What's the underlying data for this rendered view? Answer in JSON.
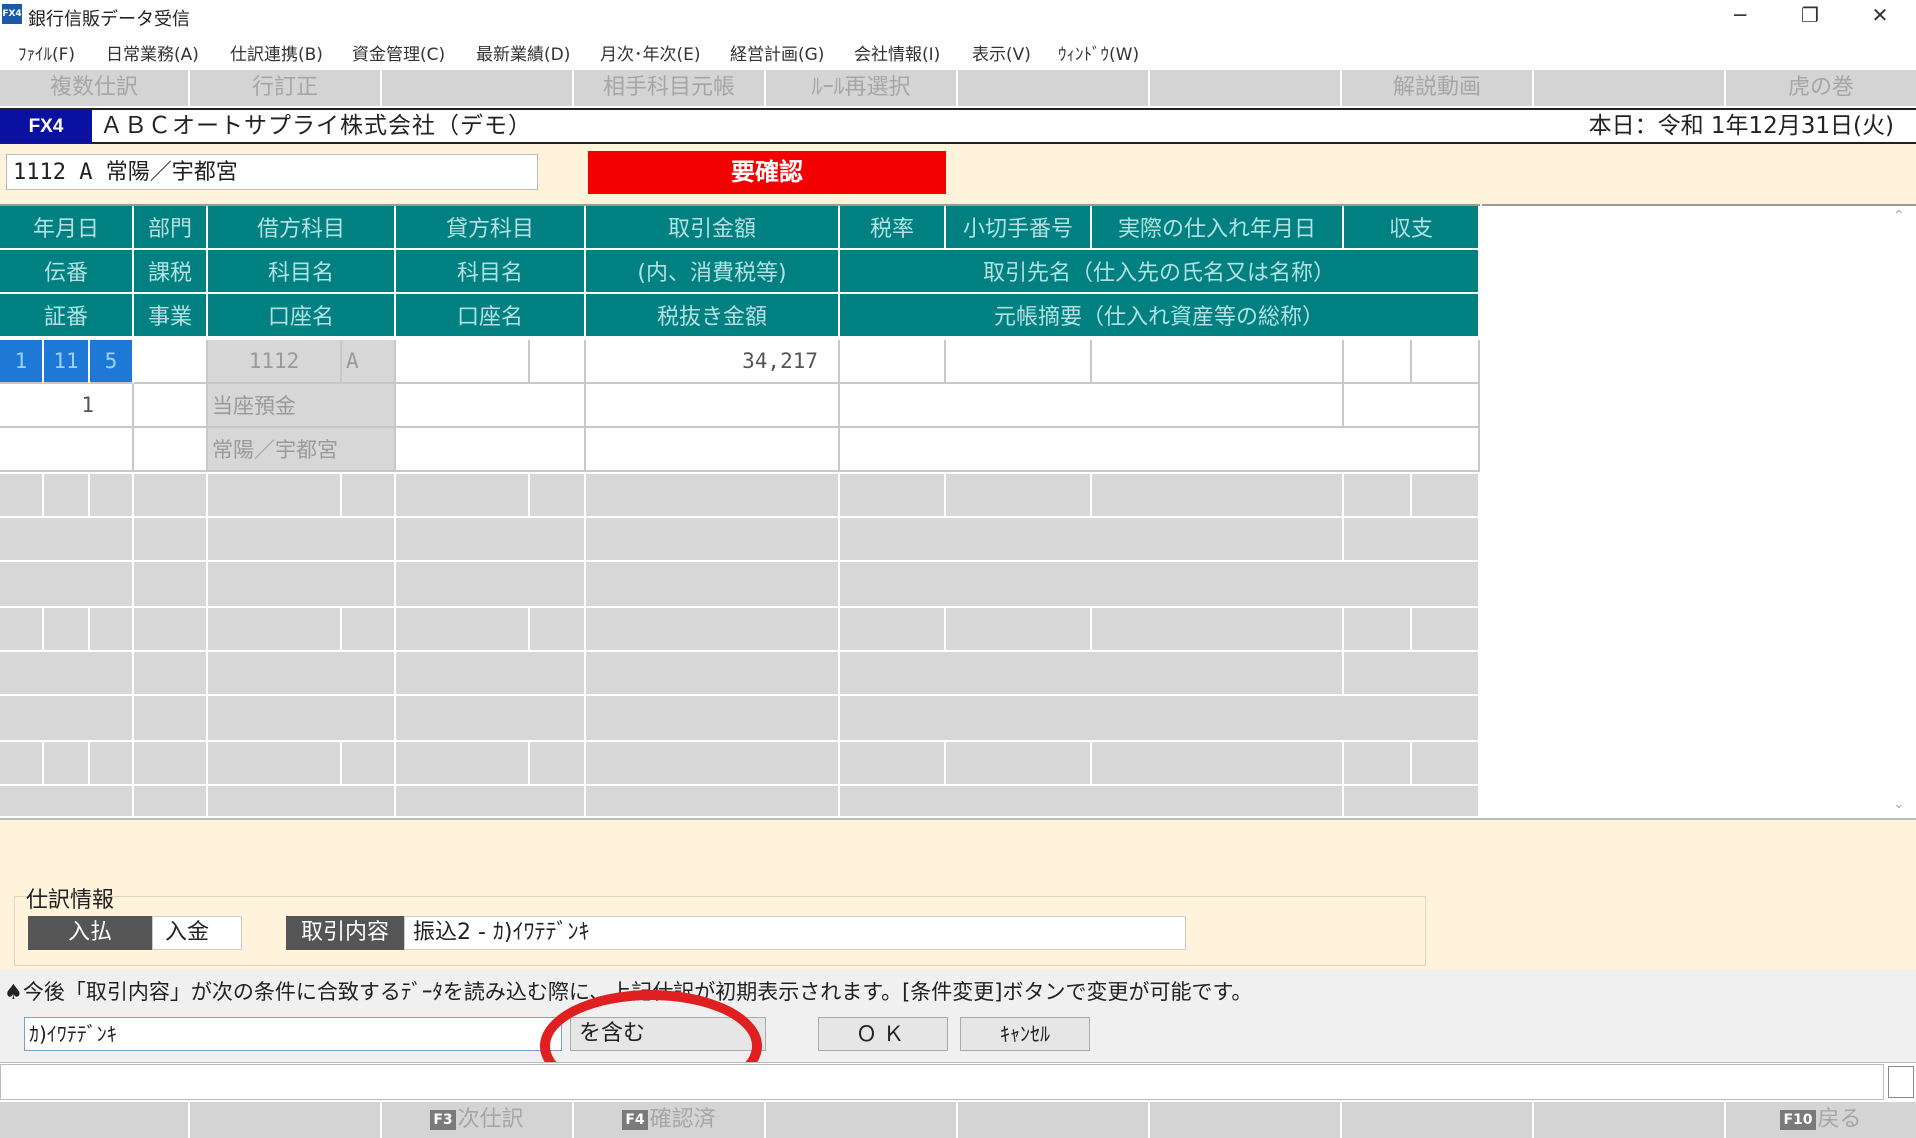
{
  "window": {
    "app_icon": "FX4",
    "title": "銀行信販データ受信",
    "controls": {
      "minimize": "─",
      "restore": "❐",
      "close": "✕"
    }
  },
  "menu": [
    "ﾌｧｲﾙ(F)",
    "日常業務(A)",
    "仕訳連携(B)",
    "資金管理(C)",
    "最新業績(D)",
    "月次･年次(E)",
    "経営計画(G)",
    "会社情報(I)",
    "表示(V)",
    "ｳｨﾝﾄﾞｳ(W)"
  ],
  "fkeys_top": [
    "複数仕訳",
    "行訂正",
    "",
    "相手科目元帳",
    "ﾙｰﾙ再選択",
    "",
    "",
    "解説動画",
    "",
    "虎の巻"
  ],
  "company": {
    "badge": "FX4",
    "name": "ＡＢＣオートサプライ株式会社（デモ）",
    "today": "本日：令和 1年12月31日(火)"
  },
  "account": {
    "value": "1112 A   常陽／宇都宮",
    "status_badge": "要確認"
  },
  "grid_headers": {
    "row1": [
      "年月日",
      "部門",
      "借方科目",
      "貸方科目",
      "取引金額",
      "税率",
      "小切手番号",
      "実際の仕入れ年月日",
      "収支"
    ],
    "row2": [
      "伝番",
      "課税",
      "科目名",
      "科目名",
      "(内、消費税等)",
      "取引先名（仕入先の氏名又は名称）"
    ],
    "row3": [
      "証番",
      "事業",
      "口座名",
      "口座名",
      "税抜き金額",
      "元帳摘要（仕入れ資産等の総称）"
    ]
  },
  "entry": {
    "month": "1",
    "day": "11",
    "seq": "5",
    "debit_code": "1112",
    "debit_sub": "A",
    "amount": "34,217",
    "slip_no": "1",
    "debit_name": "当座預金",
    "debit_account": "常陽／宇都宮"
  },
  "journal_info": {
    "label": "仕訳情報",
    "in_out_label": "入払",
    "in_out_value": "入金",
    "content_label": "取引内容",
    "content_value": "振込2 - ｶ)ｲﾜﾃﾃﾞﾝｷ"
  },
  "notice": "♠今後「取引内容」が次の条件に合致するﾃﾞｰﾀを読み込む際に、上記仕訳が初期表示されます。[条件変更]ボタンで変更が可能です。",
  "condition": {
    "input_value": "ｶ)ｲﾜﾃﾃﾞﾝｷ",
    "match_mode": "を含む",
    "ok_label": "ＯＫ",
    "cancel_label": "ｷｬﾝｾﾙ"
  },
  "fkeys_bottom": [
    {
      "num": "",
      "label": ""
    },
    {
      "num": "",
      "label": ""
    },
    {
      "num": "F3",
      "label": "次仕訳"
    },
    {
      "num": "F4",
      "label": "確認済"
    },
    {
      "num": "",
      "label": ""
    },
    {
      "num": "",
      "label": ""
    },
    {
      "num": "",
      "label": ""
    },
    {
      "num": "",
      "label": ""
    },
    {
      "num": "",
      "label": ""
    },
    {
      "num": "F10",
      "label": "戻る"
    }
  ],
  "colors": {
    "header_teal": "#008080",
    "status_red": "#f30000",
    "badge_blue": "#0a10a0",
    "panel_cream": "#fff4db",
    "annotation_red": "#e02020"
  }
}
